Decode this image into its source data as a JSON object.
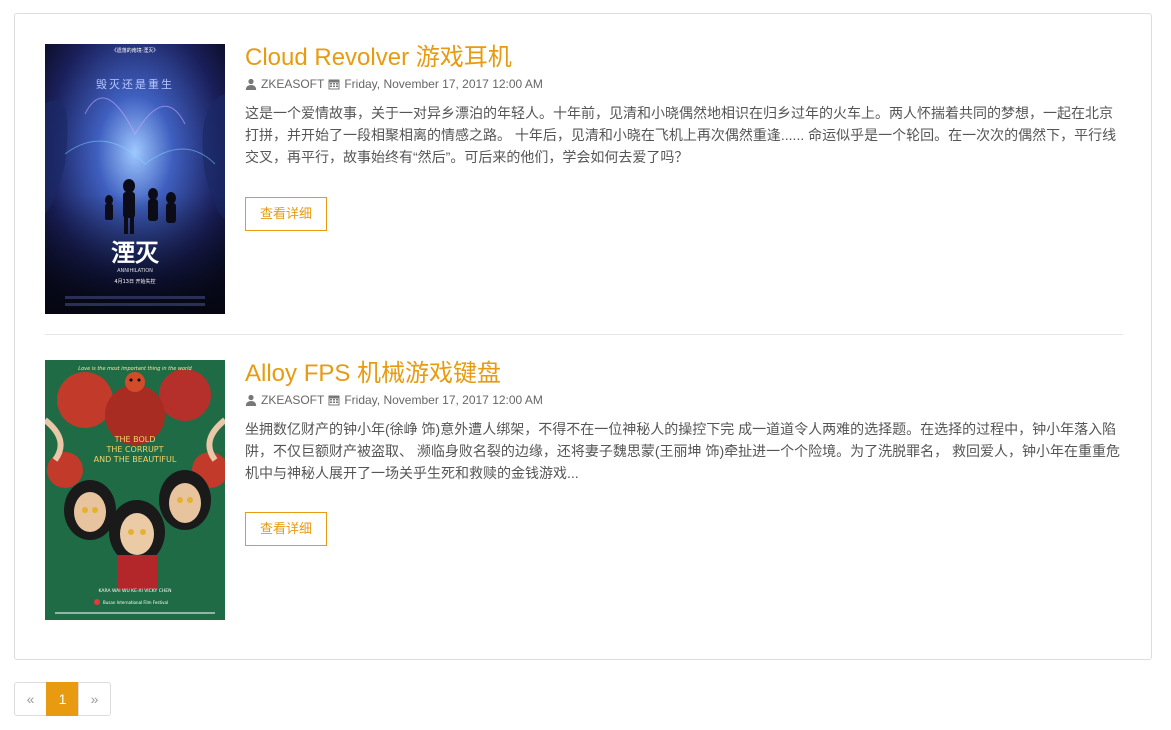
{
  "articles": [
    {
      "title": "Cloud Revolver 游戏耳机",
      "author": "ZKEASOFT",
      "date": "Friday, November 17, 2017 12:00 AM",
      "summary": "这是一个爱情故事，关于一对异乡漂泊的年轻人。十年前，见清和小晓偶然地相识在归乡过年的火车上。两人怀揣着共同的梦想，一起在北京打拼，并开始了一段相聚相离的情感之路。 十年后，见清和小晓在飞机上再次偶然重逢...... 命运似乎是一个轮回。在一次次的偶然下，平行线交叉，再平行，故事始终有“然后”。可后来的他们，学会如何去爱了吗？",
      "button": "查看详细",
      "poster": {
        "top_text": "《遗落的南境·湮灭》",
        "tagline": "毁灭还是重生",
        "title": "湮灭",
        "subtitle": "ANNIHILATION",
        "release": "4月13日 开始失控"
      }
    },
    {
      "title": "Alloy FPS 机械游戏键盘",
      "author": "ZKEASOFT",
      "date": "Friday, November 17, 2017 12:00 AM",
      "summary": "坐拥数亿财产的钟小年(徐峥 饰)意外遭人绑架，不得不在一位神秘人的操控下完 成一道道令人两难的选择题。在选择的过程中，钟小年落入陷阱，不仅巨额财产被盗取、 濒临身败名裂的边缘，还将妻子魏思蒙(王丽坤 饰)牵扯进一个个险境。为了洗脱罪名， 救回爱人，钟小年在重重危机中与神秘人展开了一场关乎生死和救赎的金钱游戏...",
      "button": "查看详细",
      "poster": {
        "top_text": "Love is the most important thing in the world",
        "title_line1": "THE BOLD",
        "title_line2": "THE CORRUPT",
        "title_line3": "AND THE BEAUTIFUL",
        "cast": "KARA WAI    WU KE-XI    VICKY CHEN",
        "festival": "Busan International Film Festival"
      }
    }
  ],
  "pagination": {
    "prev": "«",
    "current": "1",
    "next": "»"
  },
  "colors": {
    "accent": "#e89b10",
    "border": "#dddddd"
  }
}
